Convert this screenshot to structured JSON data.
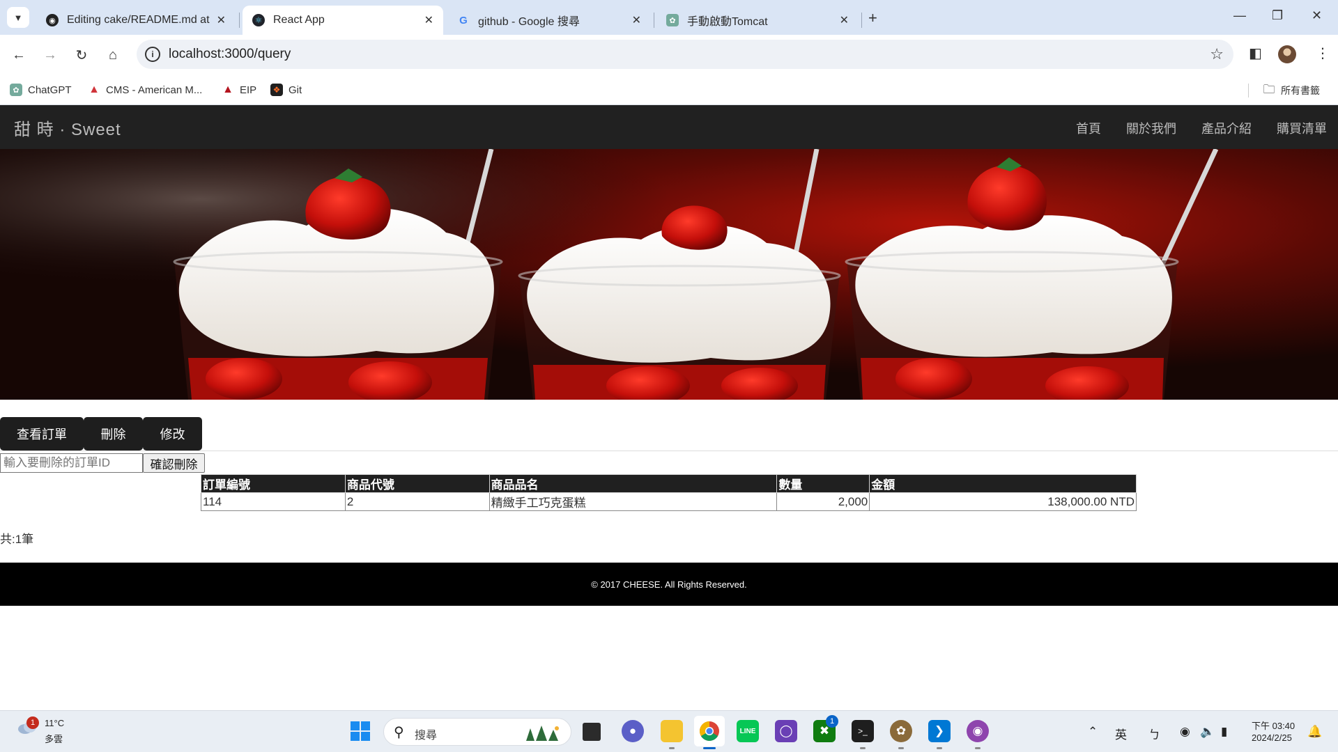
{
  "browser": {
    "tabs": [
      {
        "title": "Editing cake/README.md at m",
        "icon": "github-icon"
      },
      {
        "title": "React App",
        "icon": "react-icon"
      },
      {
        "title": "github - Google 搜尋",
        "icon": "google-icon"
      },
      {
        "title": "手動啟動Tomcat",
        "icon": "chatgpt-icon"
      }
    ],
    "url": "localhost:3000/query",
    "bookmarks": [
      {
        "label": "ChatGPT",
        "icon": "chatgpt-icon"
      },
      {
        "label": "CMS - American M...",
        "icon": "cms-icon"
      },
      {
        "label": "EIP",
        "icon": "eip-icon"
      },
      {
        "label": "Git",
        "icon": "gitlab-icon"
      }
    ],
    "all_bookmarks_label": "所有書籤"
  },
  "site": {
    "brand": "甜 時 · Sweet",
    "nav": [
      "首頁",
      "關於我們",
      "產品介紹",
      "購買清單"
    ]
  },
  "actions": {
    "view_orders": "查看訂單",
    "delete": "刪除",
    "modify": "修改"
  },
  "delete_form": {
    "placeholder": "輸入要刪除的訂單ID",
    "confirm_label": "確認刪除"
  },
  "table": {
    "headers": [
      "訂單編號",
      "商品代號",
      "商品品名",
      "數量",
      "金額"
    ],
    "rows": [
      [
        "114",
        "2",
        "精緻手工巧克蛋糕",
        "2,000",
        "138,000.00 NTD"
      ]
    ]
  },
  "total_text": "共:1筆",
  "footer_text": "© 2017 CHEESE. All Rights Reserved.",
  "taskbar": {
    "weather_temp": "11°C",
    "weather_condition": "多雲",
    "weather_badge": "1",
    "search_label": "搜尋",
    "xbox_badge": "1",
    "ime_lang": "英",
    "ime_mode": "ㄅ",
    "time": "下午 03:40",
    "date": "2024/2/25"
  },
  "colors": {
    "nav_bg": "#212121",
    "footer_bg": "#000000",
    "button_bg": "#1e1e1e",
    "tabstrip_bg": "#dae5f5"
  }
}
